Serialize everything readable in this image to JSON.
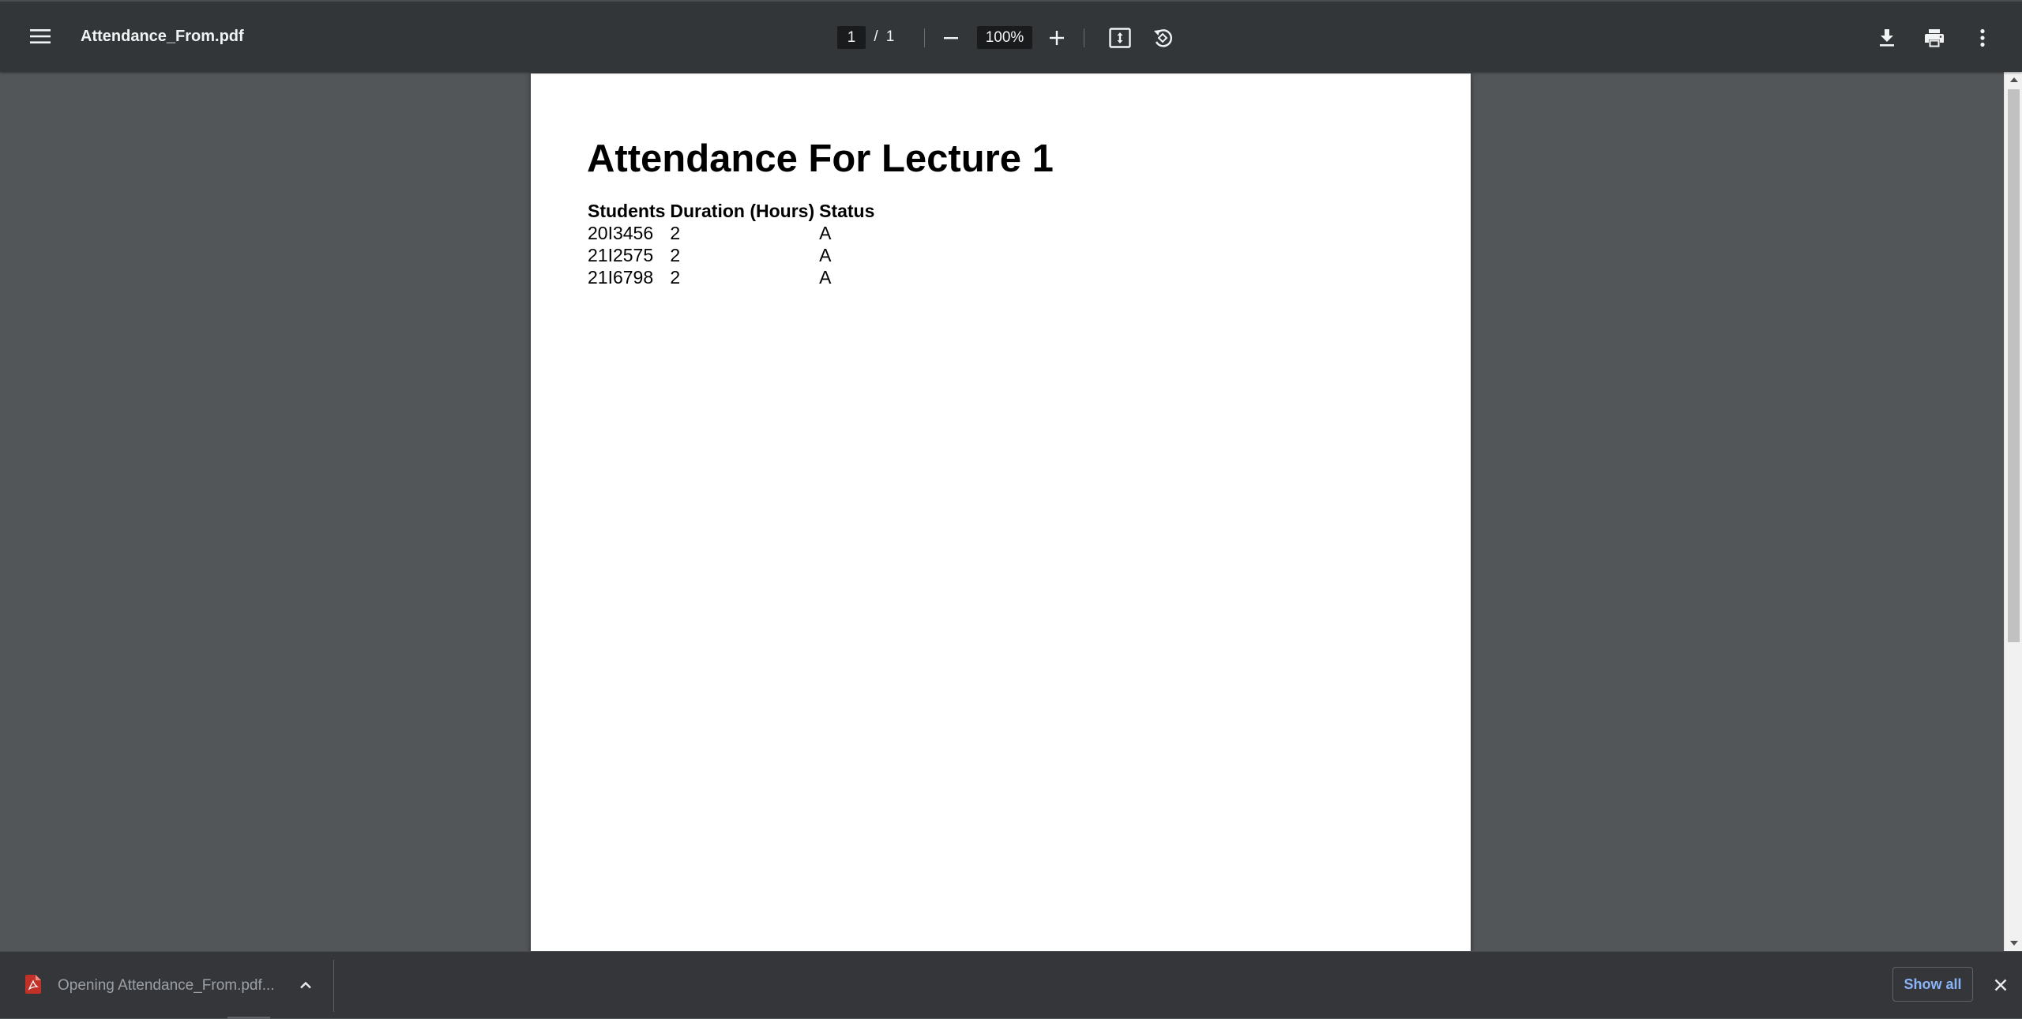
{
  "toolbar": {
    "title": "Attendance_From.pdf",
    "page_current": "1",
    "page_separator": "/",
    "page_total": "1",
    "zoom_value": "100%"
  },
  "document": {
    "heading": "Attendance For Lecture 1",
    "table": {
      "headers": [
        "Students",
        "Duration (Hours)",
        "Status"
      ],
      "rows": [
        [
          "20I3456",
          "2",
          "A"
        ],
        [
          "21I2575",
          "2",
          "A"
        ],
        [
          "21I6798",
          "2",
          "A"
        ]
      ]
    }
  },
  "download_shelf": {
    "item_text": "Opening Attendance_From.pdf...",
    "show_all_label": "Show all"
  },
  "colors": {
    "toolbar_bg": "#323639",
    "viewer_bg": "#525659",
    "shelf_bg": "#35363a",
    "link_blue": "#8ab4f8",
    "pdf_icon_red": "#d93025"
  }
}
